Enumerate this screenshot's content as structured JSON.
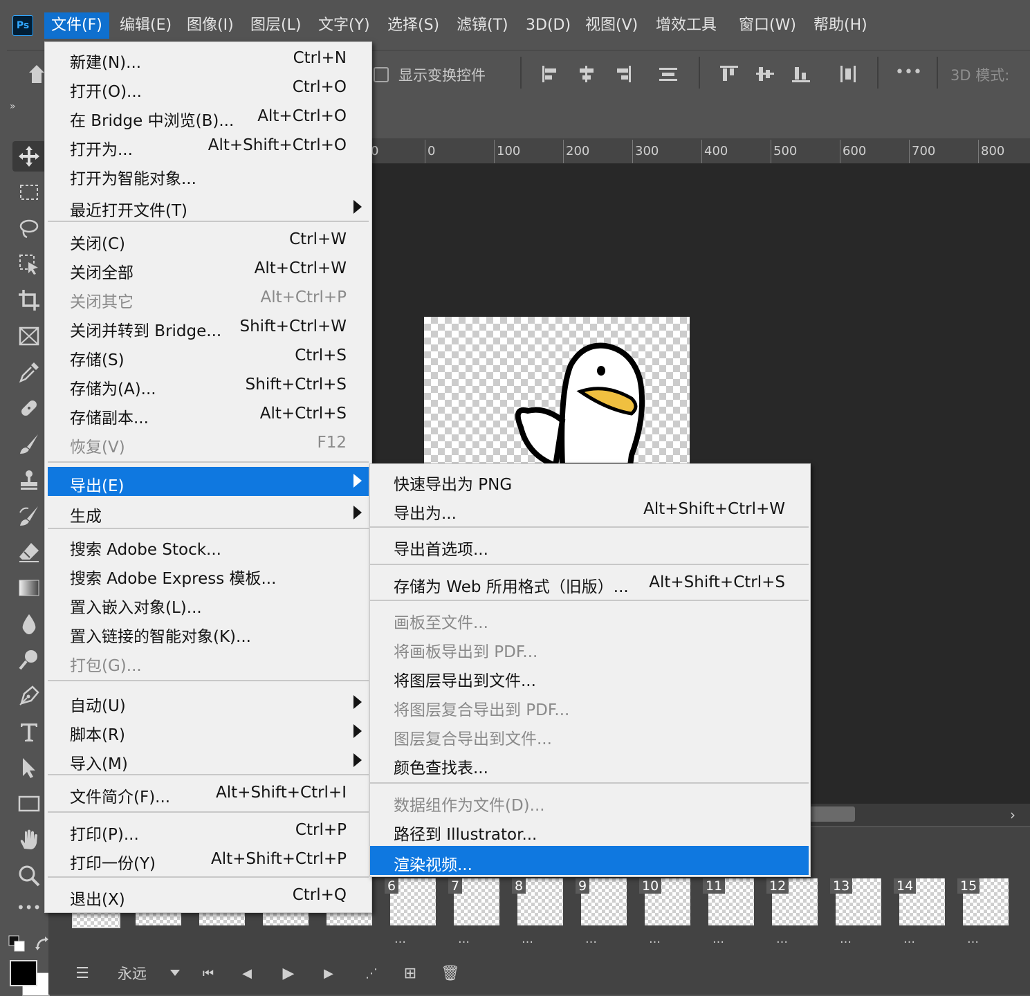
{
  "app": {
    "logo": "Ps"
  },
  "menubar": [
    "文件(F)",
    "编辑(E)",
    "图像(I)",
    "图层(L)",
    "文字(Y)",
    "选择(S)",
    "滤镜(T)",
    "3D(D)",
    "视图(V)",
    "增效工具",
    "窗口(W)",
    "帮助(H)"
  ],
  "options": {
    "show_transform": "显示变换控件",
    "mode_3d": "3D 模式:",
    "more": "•••"
  },
  "collapse_glyph": "»",
  "ruler": [
    "0",
    "0",
    "100",
    "200",
    "300",
    "400",
    "500",
    "600",
    "700",
    "800"
  ],
  "file_menu": {
    "items": [
      {
        "label": "新建(N)...",
        "shortcut": "Ctrl+N"
      },
      {
        "label": "打开(O)...",
        "shortcut": "Ctrl+O"
      },
      {
        "label": "在 Bridge 中浏览(B)...",
        "shortcut": "Alt+Ctrl+O"
      },
      {
        "label": "打开为...",
        "shortcut": "Alt+Shift+Ctrl+O"
      },
      {
        "label": "打开为智能对象...",
        "shortcut": ""
      },
      {
        "label": "最近打开文件(T)",
        "shortcut": ""
      },
      {
        "label": "关闭(C)",
        "shortcut": "Ctrl+W"
      },
      {
        "label": "关闭全部",
        "shortcut": "Alt+Ctrl+W"
      },
      {
        "label": "关闭其它",
        "shortcut": "Alt+Ctrl+P"
      },
      {
        "label": "关闭并转到 Bridge...",
        "shortcut": "Shift+Ctrl+W"
      },
      {
        "label": "存储(S)",
        "shortcut": "Ctrl+S"
      },
      {
        "label": "存储为(A)...",
        "shortcut": "Shift+Ctrl+S"
      },
      {
        "label": "存储副本...",
        "shortcut": "Alt+Ctrl+S"
      },
      {
        "label": "恢复(V)",
        "shortcut": "F12"
      },
      {
        "label": "导出(E)",
        "shortcut": ""
      },
      {
        "label": "生成",
        "shortcut": ""
      },
      {
        "label": "搜索 Adobe Stock...",
        "shortcut": ""
      },
      {
        "label": "搜索 Adobe Express 模板...",
        "shortcut": ""
      },
      {
        "label": "置入嵌入对象(L)...",
        "shortcut": ""
      },
      {
        "label": "置入链接的智能对象(K)...",
        "shortcut": ""
      },
      {
        "label": "打包(G)...",
        "shortcut": ""
      },
      {
        "label": "自动(U)",
        "shortcut": ""
      },
      {
        "label": "脚本(R)",
        "shortcut": ""
      },
      {
        "label": "导入(M)",
        "shortcut": ""
      },
      {
        "label": "文件简介(F)...",
        "shortcut": "Alt+Shift+Ctrl+I"
      },
      {
        "label": "打印(P)...",
        "shortcut": "Ctrl+P"
      },
      {
        "label": "打印一份(Y)",
        "shortcut": "Alt+Shift+Ctrl+P"
      },
      {
        "label": "退出(X)",
        "shortcut": "Ctrl+Q"
      }
    ]
  },
  "export_submenu": {
    "items": [
      {
        "label": "快速导出为 PNG",
        "shortcut": ""
      },
      {
        "label": "导出为...",
        "shortcut": "Alt+Shift+Ctrl+W"
      },
      {
        "label": "导出首选项...",
        "shortcut": ""
      },
      {
        "label": "存储为 Web 所用格式（旧版）...",
        "shortcut": "Alt+Shift+Ctrl+S"
      },
      {
        "label": "画板至文件...",
        "shortcut": ""
      },
      {
        "label": "将画板导出到 PDF...",
        "shortcut": ""
      },
      {
        "label": "将图层导出到文件...",
        "shortcut": ""
      },
      {
        "label": "将图层复合导出到 PDF...",
        "shortcut": ""
      },
      {
        "label": "图层复合导出到文件...",
        "shortcut": ""
      },
      {
        "label": "颜色查找表...",
        "shortcut": ""
      },
      {
        "label": "数据组作为文件(D)...",
        "shortcut": ""
      },
      {
        "label": "路径到 Illustrator...",
        "shortcut": ""
      },
      {
        "label": "渲染视频...",
        "shortcut": ""
      }
    ]
  },
  "timeline": {
    "frames": [
      "6",
      "7",
      "8",
      "9",
      "10",
      "11",
      "12",
      "13",
      "14",
      "15"
    ],
    "delay_label": "…",
    "loop": "永远"
  },
  "colors": {
    "accent": "#0f78e0",
    "menubar_active": "#0f70cf",
    "bg": "#535353"
  }
}
